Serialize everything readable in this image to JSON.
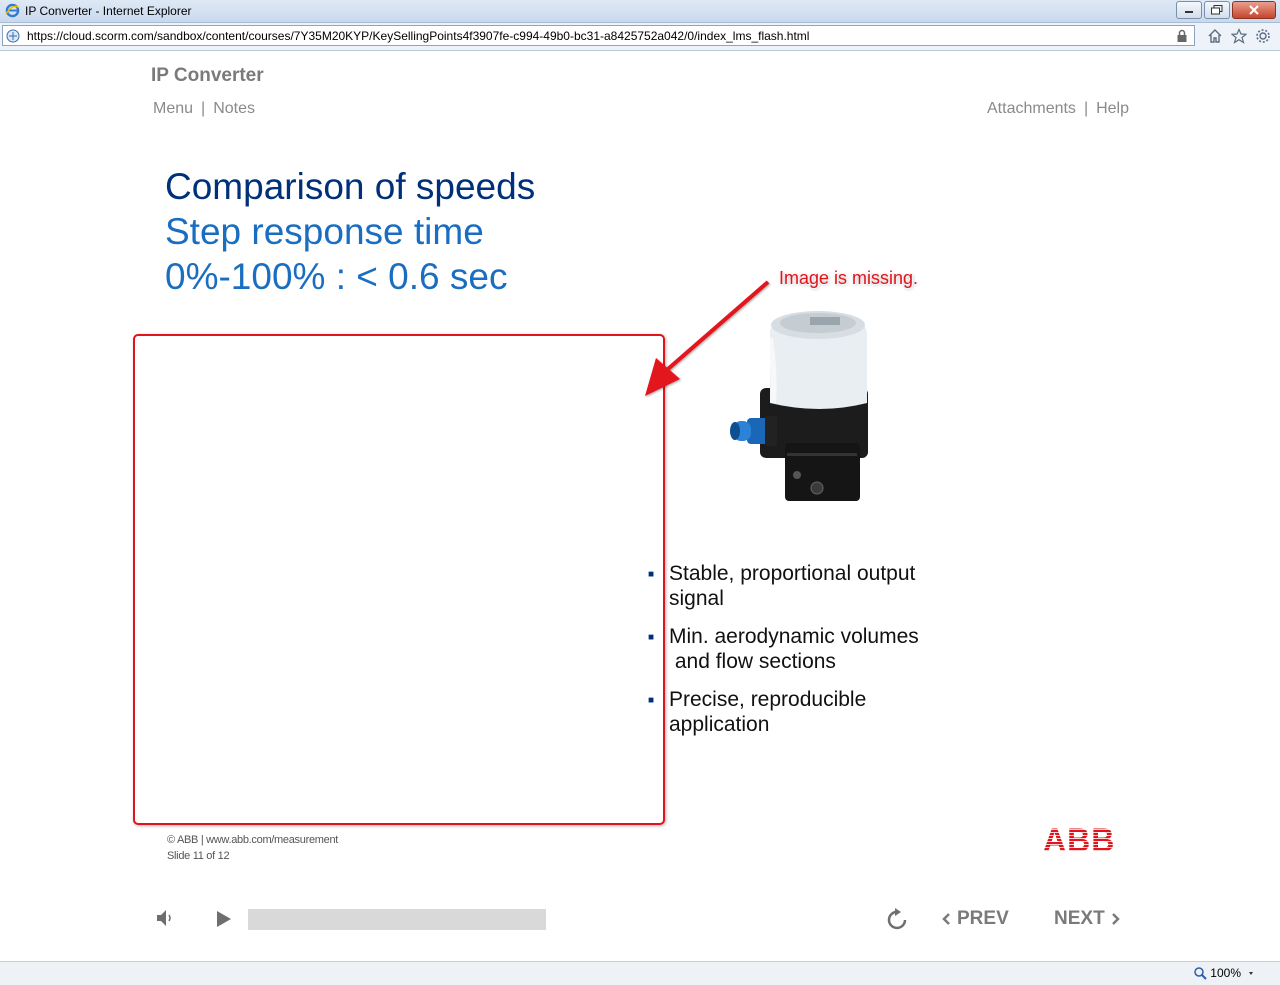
{
  "browser": {
    "window_title": "IP Converter - Internet Explorer",
    "url": "https://cloud.scorm.com/sandbox/content/courses/7Y35M20KYP/KeySellingPoints4f3907fe-c994-49b0-bc31-a8425752a042/0/index_lms_flash.html",
    "zoom": "100%"
  },
  "course": {
    "title": "IP Converter",
    "nav_left": [
      "Menu",
      "Notes"
    ],
    "nav_right": [
      "Attachments",
      "Help"
    ]
  },
  "slide": {
    "heading1": "Comparison of speeds",
    "heading2": "Step response time",
    "heading3": "0%-100% : < 0.6 sec",
    "callout": "Image is missing.",
    "bullets": [
      [
        "Stable, proportional output",
        "signal"
      ],
      [
        "Min. aerodynamic volumes",
        " and flow sections"
      ],
      [
        "Precise, reproducible",
        "application"
      ]
    ],
    "footer_copy": "© ABB | www.abb.com/measurement",
    "footer_slide": "Slide 11 of 12",
    "logo_text": "ABB"
  },
  "player": {
    "prev_label": "PREV",
    "next_label": "NEXT",
    "progress_fraction": 0.0
  },
  "colors": {
    "heading_dark": "#00307a",
    "heading_light": "#1a6ec2",
    "callout_red": "#e2131b",
    "abb_red": "#e2131b"
  }
}
